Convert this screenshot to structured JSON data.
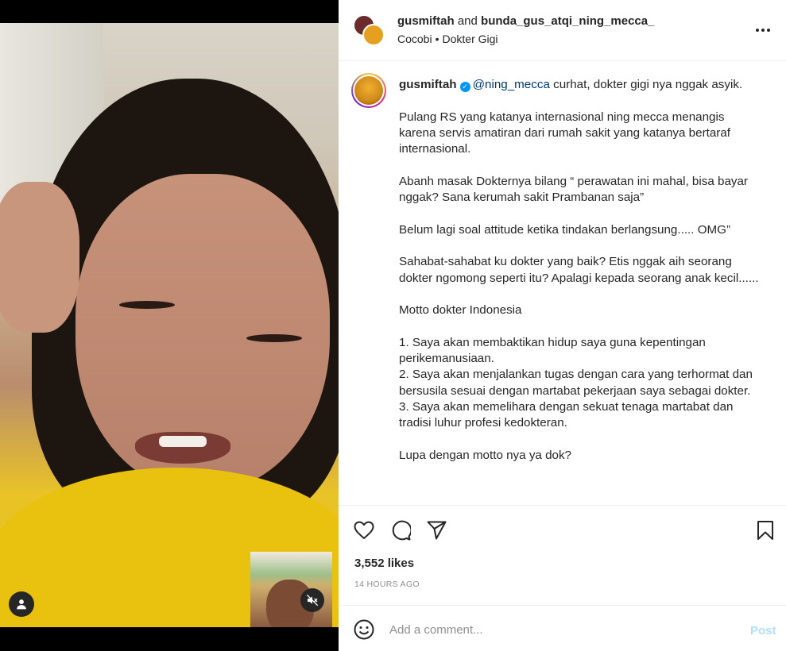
{
  "header": {
    "user1": "gusmiftah",
    "and": "and",
    "user2": "bunda_gus_atqi_ning_mecca_",
    "location": "Cocobi",
    "separator": "•",
    "audio": "Dokter Gigi",
    "more_icon": "more-horizontal-icon"
  },
  "caption": {
    "username": "gusmiftah",
    "mention": "@ning_mecca",
    "line1": " curhat, dokter gigi nya nggak asyik.",
    "p1": "Pulang RS yang katanya internasional ning mecca menangis karena servis amatiran dari rumah sakit yang katanya bertaraf internasional.",
    "p2": "Abanh masak Dokternya bilang “ perawatan ini mahal, bisa bayar nggak? Sana kerumah sakit Prambanan saja”",
    "p3": "Belum lagi soal attitude ketika tindakan berlangsung..... OMG”",
    "p4": "Sahabat-sahabat ku dokter yang baik? Etis nggak aih seorang dokter ngomong seperti itu? Apalagi kepada seorang anak kecil......",
    "p5": "Motto dokter Indonesia",
    "l1": "1. Saya akan membaktikan hidup saya guna kepentingan perikemanusiaan.",
    "l2": "2. Saya akan menjalankan tugas dengan cara yang terhormat dan bersusila sesuai dengan martabat pekerjaan saya sebagai dokter.",
    "l3": "3. Saya akan memelihara dengan sekuat tenaga martabat dan tradisi luhur profesi kedokteran.",
    "p6": "Lupa dengan motto nya ya dok?"
  },
  "actions": {
    "like_icon": "heart-icon",
    "comment_icon": "comment-icon",
    "share_icon": "send-icon",
    "save_icon": "bookmark-icon"
  },
  "likes": "3,552 likes",
  "time": "14 HOURS AGO",
  "comment": {
    "placeholder": "Add a comment...",
    "post": "Post",
    "emoji_icon": "smile-icon"
  },
  "media": {
    "user_icon": "user-tag-icon",
    "mute_icon": "speaker-muted-icon"
  },
  "colors": {
    "link": "#00376b",
    "verified": "#0095f6",
    "post_disabled": "#b2dffc",
    "muted_text": "#8e8e8e"
  }
}
